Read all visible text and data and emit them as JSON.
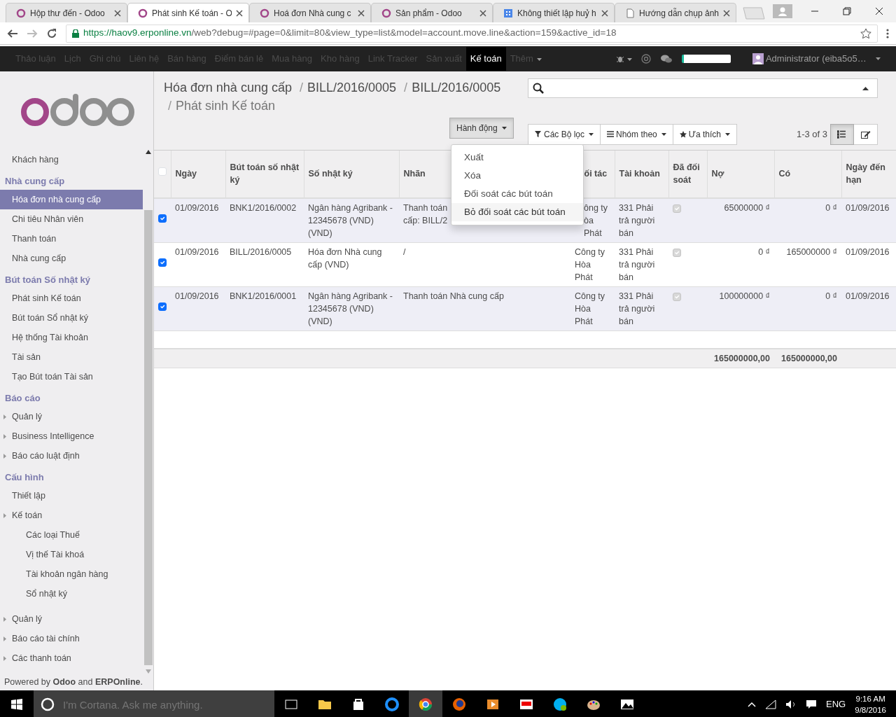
{
  "browser_tabs": [
    {
      "title": "Hộp thư đến - Odoo",
      "kind": "odoo",
      "selected": false
    },
    {
      "title": "Phát sinh Kế toán - O",
      "kind": "odoo",
      "selected": true
    },
    {
      "title": "Hoá đơn Nhà cung c",
      "kind": "odoo",
      "selected": false
    },
    {
      "title": "Sản phẩm - Odoo",
      "kind": "odoo",
      "selected": false
    },
    {
      "title": "Không thiết lập huỷ h",
      "kind": "grid",
      "selected": false
    },
    {
      "title": "Hướng dẫn chụp ảnh",
      "kind": "document",
      "selected": false
    }
  ],
  "address_bar": {
    "host": "https://haov9.erponline.vn",
    "path": "/web?debug=#page=0&limit=80&view_type=list&model=account.move.line&action=159&active_id=18"
  },
  "top_menu": [
    {
      "label": "Thảo luận",
      "selected": false
    },
    {
      "label": "Lịch",
      "selected": false
    },
    {
      "label": "Ghi chú",
      "selected": false
    },
    {
      "label": "Liên hệ",
      "selected": false
    },
    {
      "label": "Bán hàng",
      "selected": false
    },
    {
      "label": "Điểm bán lẻ",
      "selected": false
    },
    {
      "label": "Mua hàng",
      "selected": false
    },
    {
      "label": "Kho hàng",
      "selected": false
    },
    {
      "label": "Link Tracker",
      "selected": false
    },
    {
      "label": "Sản xuất",
      "selected": false
    },
    {
      "label": "Kế toán",
      "selected": true
    },
    {
      "label": "Thêm",
      "selected": false,
      "dropdown": true
    }
  ],
  "user": {
    "name": "Administrator (eiba5o5…"
  },
  "sidebar": [
    {
      "kind": "item",
      "label": "Khách hàng",
      "selected": false
    },
    {
      "kind": "header",
      "label": "Nhà cung cấp"
    },
    {
      "kind": "item",
      "label": "Hóa đơn nhà cung cấp",
      "selected": true
    },
    {
      "kind": "item",
      "label": "Chi tiêu Nhân viên",
      "selected": false
    },
    {
      "kind": "item",
      "label": "Thanh toán",
      "selected": false
    },
    {
      "kind": "item",
      "label": "Nhà cung cấp",
      "selected": false
    },
    {
      "kind": "header",
      "label": "Bút toán Số nhật ký"
    },
    {
      "kind": "item",
      "label": "Phát sinh Kế toán",
      "selected": false
    },
    {
      "kind": "item",
      "label": "Bút toán Sổ nhật ký",
      "selected": false
    },
    {
      "kind": "item",
      "label": "Hệ thống Tài khoản",
      "selected": false
    },
    {
      "kind": "item",
      "label": "Tài sản",
      "selected": false
    },
    {
      "kind": "item",
      "label": "Tạo Bút toán Tài sản",
      "selected": false
    },
    {
      "kind": "header",
      "label": "Báo cáo"
    },
    {
      "kind": "folder",
      "label": "Quản lý",
      "selected": false
    },
    {
      "kind": "folder",
      "label": "Business Intelligence",
      "selected": false
    },
    {
      "kind": "folder",
      "label": "Báo cáo luật định",
      "selected": false
    },
    {
      "kind": "header",
      "label": "Cấu hình"
    },
    {
      "kind": "item",
      "label": "Thiết lập",
      "selected": false
    },
    {
      "kind": "folder",
      "label": "Kế toán",
      "selected": false,
      "children": [
        {
          "kind": "item",
          "label": "Các loại Thuế",
          "selected": false
        },
        {
          "kind": "item",
          "label": "Vị thế Tài khoá",
          "selected": false
        },
        {
          "kind": "item",
          "label": "Tài khoản ngân hàng",
          "selected": false
        },
        {
          "kind": "item",
          "label": "Sổ nhật ký",
          "selected": false
        }
      ]
    },
    {
      "kind": "folder",
      "label": "Quản lý",
      "selected": false
    },
    {
      "kind": "folder",
      "label": "Báo cáo tài chính",
      "selected": false
    },
    {
      "kind": "folder",
      "label": "Các thanh toán",
      "selected": false
    }
  ],
  "powered_by": "Powered by **Odoo** and **ERPOnline**.",
  "breadcrumbs": [
    {
      "label": "Hóa đơn nhà cung cấp"
    },
    {
      "separator": "/",
      "label": "BILL/2016/0005"
    },
    {
      "separator": "/",
      "label": "BILL/2016/0005"
    },
    {
      "separator": "/",
      "label": "Phát sinh Kế toán"
    }
  ],
  "toolbar": {
    "action_button": "Hành động",
    "action_open": true,
    "action_menu": [
      {
        "label": "Xuất",
        "selected": false
      },
      {
        "label": "Xóa",
        "selected": false
      },
      {
        "label": "Đối soát các bút toán",
        "selected": false
      },
      {
        "label": "Bỏ đối soát các bút toán",
        "selected": true
      }
    ],
    "filters": [
      "Các Bộ lọc",
      "Nhóm theo",
      "Ưa thích"
    ],
    "pager": "1-3 of 3",
    "views": [
      {
        "kind": "list",
        "selected": true
      },
      {
        "kind": "form",
        "selected": false
      }
    ]
  },
  "table": {
    "header_checked": false,
    "columns": [
      "Ngày",
      "Bút toán số nhật ký",
      "Số nhật ký",
      "Nhãn",
      "ối tác",
      "Tài khoản",
      "Đã đối soát",
      "Nợ",
      "Có",
      "Ngày đến hạn"
    ],
    "rows": [
      {
        "selected": true,
        "cells": [
          "01/09/2016",
          "BNK1/2016/0002",
          "Ngân hàng Agribank - 12345678 (VND) (VND)",
          "Thanh toán\ncấp: BILL/2",
          "ông ty\nòa\nPhát",
          "331 Phải trả người bán"
        ],
        "reconciled": true,
        "debit": "65000000 ₫",
        "credit": "0 ₫",
        "due": "01/09/2016"
      },
      {
        "selected": true,
        "cells": [
          "01/09/2016",
          "BILL/2016/0005",
          "Hóa đơn Nhà cung cấp (VND)",
          "/",
          "Công ty Hòa Phát",
          "331 Phải trả người bán"
        ],
        "reconciled": true,
        "debit": "0 ₫",
        "credit": "165000000 ₫",
        "due": "01/09/2016"
      },
      {
        "selected": true,
        "cells": [
          "01/09/2016",
          "BNK1/2016/0001",
          "Ngân hàng Agribank - 12345678 (VND) (VND)",
          "Thanh toán Nhà cung cấp",
          "Công ty Hòa Phát",
          "331 Phải trả người bán"
        ],
        "reconciled": true,
        "debit": "100000000 ₫",
        "credit": "0 ₫",
        "due": "01/09/2016"
      }
    ],
    "totals": {
      "debit": "165000000,00",
      "credit": "165000000,00"
    }
  },
  "taskbar": {
    "search_placeholder": "I'm Cortana. Ask me anything.",
    "language": "ENG",
    "time": "9:16 AM",
    "date": "9/8/2016"
  }
}
